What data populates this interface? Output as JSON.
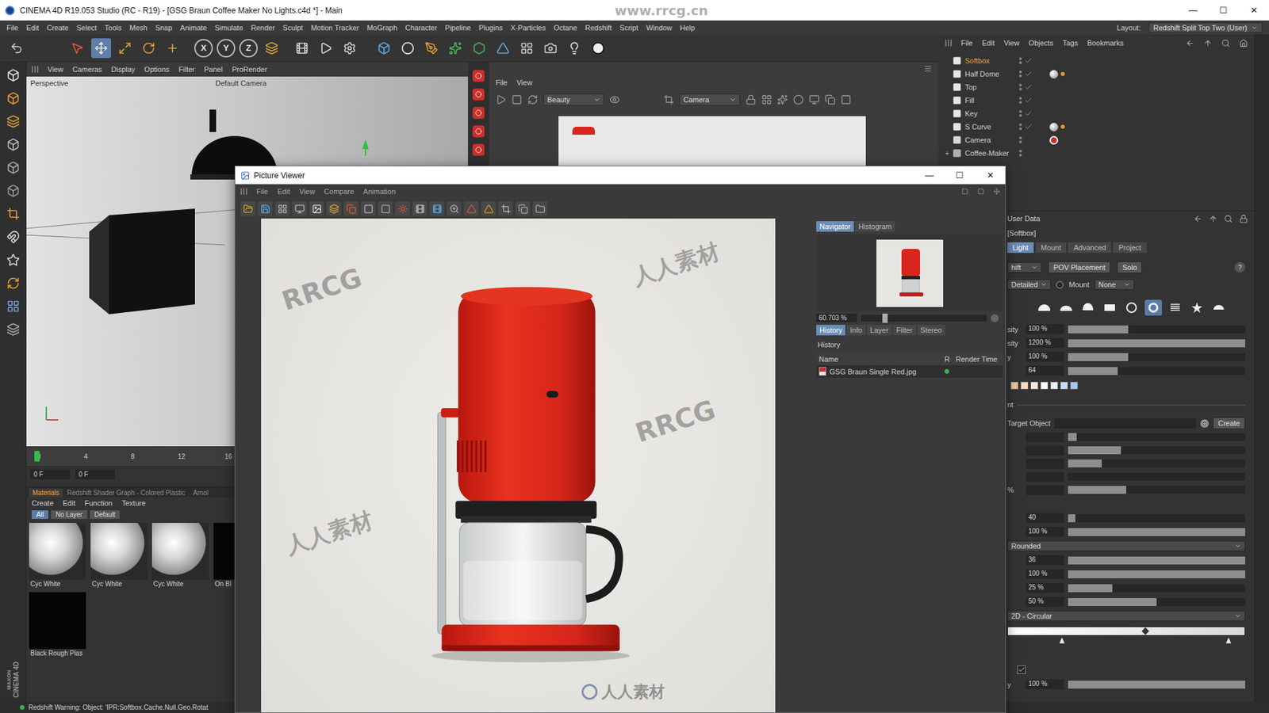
{
  "window": {
    "title": "CINEMA 4D R19.053 Studio (RC - R19) - [GSG Braun Coffee Maker No Lights.c4d *] - Main",
    "controls": [
      "—",
      "☐",
      "✕"
    ]
  },
  "menu": [
    "File",
    "Edit",
    "Create",
    "Select",
    "Tools",
    "Mesh",
    "Snap",
    "Animate",
    "Simulate",
    "Render",
    "Sculpt",
    "Motion Tracker",
    "MoGraph",
    "Character",
    "Pipeline",
    "Plugins",
    "X-Particles",
    "Octane",
    "Redshift",
    "Script",
    "Window",
    "Help"
  ],
  "layout": {
    "label": "Layout:",
    "value": "Redshift Split Top Two (User)"
  },
  "toolbar": {
    "axes": [
      "X",
      "Y",
      "Z"
    ]
  },
  "viewport": {
    "menu": [
      "View",
      "Cameras",
      "Display",
      "Options",
      "Filter",
      "Panel",
      "ProRender"
    ],
    "name": "Perspective",
    "camera": "Default Camera"
  },
  "timeline": {
    "ticks": [
      "0",
      "4",
      "8",
      "12",
      "16"
    ],
    "level": 0,
    "frames": [
      "0 F",
      "0 F"
    ]
  },
  "materials": {
    "tabs": [
      {
        "label": "Materials",
        "selected": true
      },
      {
        "label": "Redshift Shader Graph - Colored Plastic",
        "selected": false
      },
      {
        "label": "Arnol",
        "selected": false
      }
    ],
    "menu": [
      "Create",
      "Edit",
      "Function",
      "Texture"
    ],
    "filters": [
      {
        "label": "All",
        "selected": true
      },
      {
        "label": "No Layer",
        "selected": false
      },
      {
        "label": "Default",
        "selected": false
      }
    ],
    "items": [
      {
        "name": "Cyc White",
        "kind": "sphere"
      },
      {
        "name": "Cyc White",
        "kind": "sphere"
      },
      {
        "name": "Cyc White",
        "kind": "sphere"
      },
      {
        "name": "On Bl",
        "kind": "black"
      },
      {
        "name": "Black Rough Plas",
        "kind": "black"
      }
    ]
  },
  "render_view": {
    "menu": [
      "File",
      "View"
    ],
    "pass": "Beauty",
    "camera": "Camera"
  },
  "objects": {
    "menu": [
      "File",
      "Edit",
      "View",
      "Objects",
      "Tags",
      "Bookmarks"
    ],
    "items": [
      {
        "name": "Softbox",
        "selected": true,
        "enabled": true,
        "kind": "object",
        "expanded": false,
        "tags": []
      },
      {
        "name": "Half Dome",
        "selected": false,
        "enabled": true,
        "kind": "object",
        "expanded": false,
        "tags": [
          "material",
          "dot"
        ]
      },
      {
        "name": "Top",
        "selected": false,
        "enabled": true,
        "kind": "object",
        "expanded": false,
        "tags": []
      },
      {
        "name": "Fill",
        "selected": false,
        "enabled": true,
        "kind": "object",
        "expanded": false,
        "tags": []
      },
      {
        "name": "Key",
        "selected": false,
        "enabled": true,
        "kind": "object",
        "expanded": false,
        "tags": []
      },
      {
        "name": "S Curve",
        "selected": false,
        "enabled": true,
        "kind": "object",
        "expanded": false,
        "tags": [
          "material",
          "dot"
        ]
      },
      {
        "name": "Camera",
        "selected": false,
        "enabled": false,
        "kind": "object",
        "expanded": false,
        "tags": [
          "target"
        ]
      },
      {
        "name": "Coffee-Maker",
        "selected": false,
        "enabled": false,
        "kind": "group",
        "expanded": false,
        "tags": []
      }
    ]
  },
  "attributes": {
    "header": "User Data",
    "object": "[Softbox]",
    "tabs": [
      {
        "label": "Light",
        "selected": true
      },
      {
        "label": "Mount",
        "selected": false
      },
      {
        "label": "Advanced",
        "selected": false
      },
      {
        "label": "Project",
        "selected": false
      }
    ],
    "rows": [
      {
        "kind": "controls",
        "mode": "hift",
        "buttons": [
          "POV Placement",
          "Solo"
        ],
        "help": "?"
      },
      {
        "kind": "mount",
        "detail": "Detailed",
        "label": "Mount",
        "checked": false,
        "value": "None"
      },
      {
        "kind": "shapes",
        "shapes": [
          {
            "selected": false
          },
          {
            "selected": false
          },
          {
            "selected": false
          },
          {
            "selected": false
          },
          {
            "selected": false
          },
          {
            "selected": true
          },
          {
            "selected": false
          },
          {
            "selected": false
          },
          {
            "selected": false
          }
        ]
      },
      {
        "kind": "slider",
        "label": "sity",
        "value": "100 %",
        "level": 0.34
      },
      {
        "kind": "slider",
        "label": "sity",
        "value": "1200 %",
        "level": 1
      },
      {
        "kind": "slider",
        "label": "y",
        "value": "100 %",
        "level": 0.34
      },
      {
        "kind": "slider",
        "label": "",
        "value": "64",
        "level": 0.28
      },
      {
        "kind": "swatches",
        "colors": [
          "#f0c39a",
          "#f5dcc0",
          "#f7ebe0",
          "#ffffff",
          "#e6eefa",
          "#c9dcf7",
          "#a7c8f2"
        ]
      },
      {
        "kind": "section",
        "label": "nt"
      },
      {
        "kind": "target",
        "label": "Target Object",
        "button": "Create"
      },
      {
        "kind": "slider",
        "label": "",
        "value": "",
        "level": 0.05
      },
      {
        "kind": "slider",
        "label": "",
        "value": "",
        "level": 0.3
      },
      {
        "kind": "slider",
        "label": "",
        "value": "",
        "level": 0.19
      },
      {
        "kind": "slider",
        "label": "",
        "value": "",
        "level": 0
      },
      {
        "kind": "slider",
        "label": "%",
        "value": "",
        "level": 0.33
      },
      {
        "kind": "gap"
      },
      {
        "kind": "slider",
        "label": "",
        "value": "40",
        "level": 0.04
      },
      {
        "kind": "slider",
        "label": "",
        "value": "100 %",
        "level": 1
      },
      {
        "kind": "dropdown",
        "value": "Rounded"
      },
      {
        "kind": "slider",
        "label": "",
        "value": "36",
        "level": 1
      },
      {
        "kind": "slider",
        "label": "",
        "value": "100 %",
        "level": 1
      },
      {
        "kind": "slider",
        "label": "",
        "value": "25 %",
        "level": 0.25
      },
      {
        "kind": "slider",
        "label": "",
        "value": "50 %",
        "level": 0.5
      },
      {
        "kind": "dropdown",
        "value": "2D - Circular"
      },
      {
        "kind": "gradient",
        "level": 0.58,
        "stops": [
          0.23,
          0.93
        ]
      },
      {
        "kind": "gap"
      },
      {
        "kind": "checkbox",
        "checked": true
      },
      {
        "kind": "slider",
        "label": "y",
        "value": "100 %",
        "level": 1
      }
    ]
  },
  "picture_viewer": {
    "title": "Picture Viewer",
    "controls": [
      "—",
      "☐",
      "✕"
    ],
    "menu": [
      "File",
      "Edit",
      "View",
      "Compare",
      "Animation"
    ],
    "panel_tabs": [
      {
        "label": "Navigator",
        "selected": true
      },
      {
        "label": "Histogram",
        "selected": false
      }
    ],
    "zoom": {
      "value": "60.703 %",
      "level": 0.19
    },
    "info_tabs": [
      {
        "label": "History",
        "selected": true
      },
      {
        "label": "Info",
        "selected": false
      },
      {
        "label": "Layer",
        "selected": false
      },
      {
        "label": "Filter",
        "selected": false
      },
      {
        "label": "Stereo",
        "selected": false
      }
    ],
    "history_label": "History",
    "columns": [
      "Name",
      "R",
      "Render Time"
    ],
    "rows": [
      {
        "name": "GSG Braun Single Red.jpg",
        "done": true
      }
    ]
  },
  "status": {
    "text": "Redshift Warning: Object: 'IPR:Softbox.Cache.Null.Geo.Rotat"
  },
  "logo": [
    "MAXON",
    "CINEMA 4D"
  ],
  "watermarks": {
    "site": "www.rrcg.cn",
    "marks": [
      "RRCG",
      "人人素材",
      "RRCG",
      "人人素材"
    ],
    "logo": "人人素材"
  }
}
